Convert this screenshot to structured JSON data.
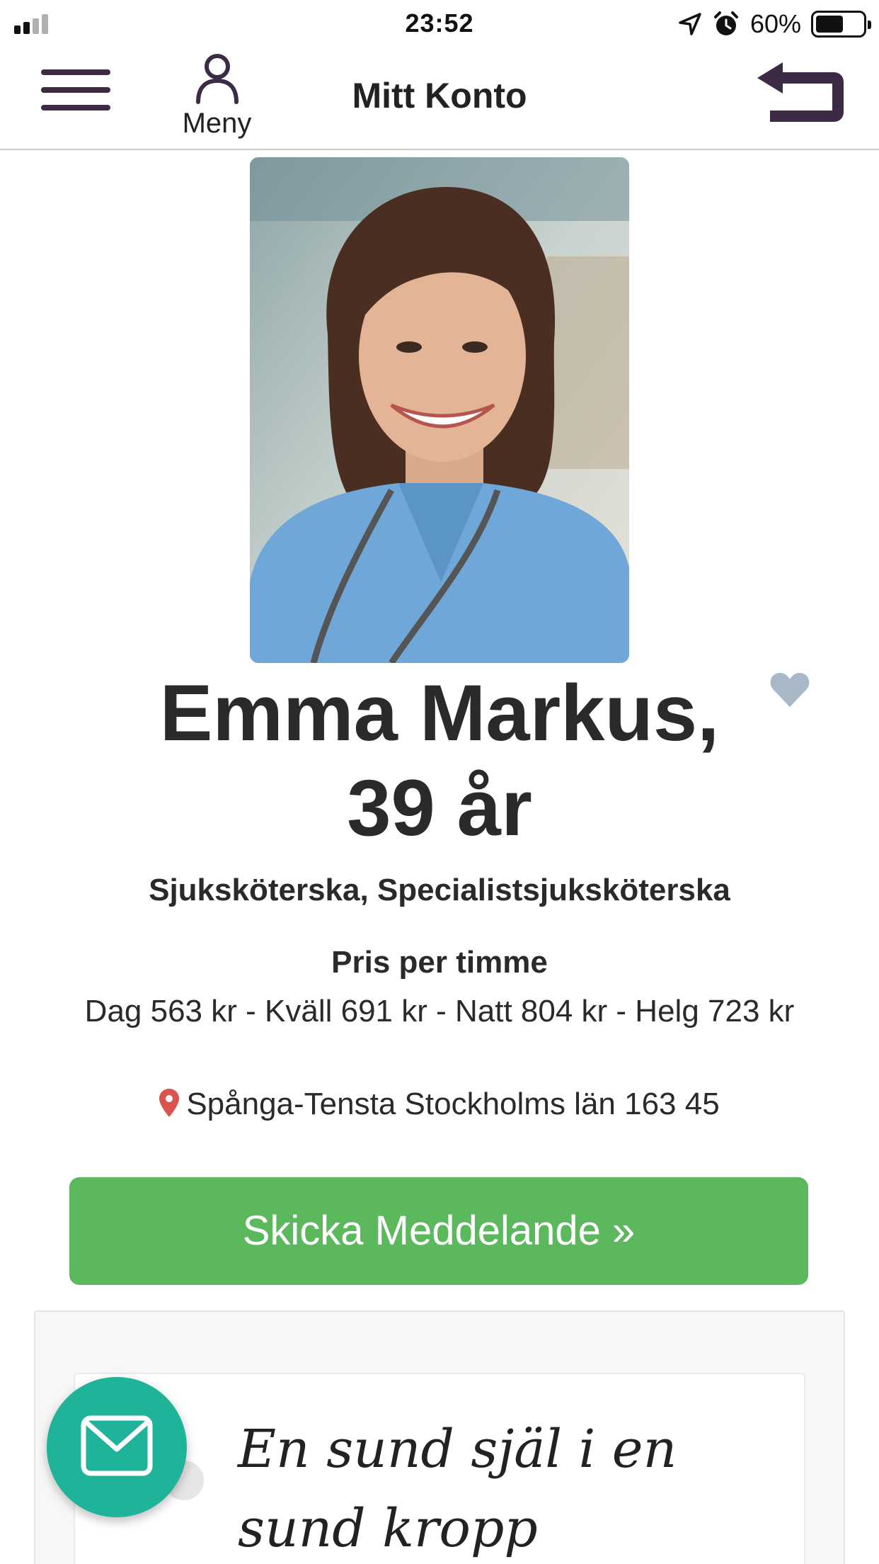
{
  "status_bar": {
    "time": "23:52",
    "battery_percent": "60%",
    "battery_level": 0.6
  },
  "header": {
    "menu_label": "Meny",
    "title": "Mitt Konto"
  },
  "profile": {
    "name": "Emma Markus,",
    "age": "39 år",
    "profession": "Sjuksköterska, Specialistsjuksköterska",
    "price_heading": "Pris per timme",
    "prices": "Dag 563 kr - Kväll 691 kr - Natt 804 kr - Helg 723 kr",
    "location": "Spånga-Tensta Stockholms län 163 45"
  },
  "actions": {
    "send_message": "Skicka Meddelande »"
  },
  "card": {
    "quote_line1": "En sund själ i en",
    "quote_line2": "sund kropp"
  },
  "colors": {
    "brand_dark": "#3d2a45",
    "button_green": "#5cb85c",
    "fab_teal": "#1fb39a",
    "heart": "#a9b8c6",
    "pin": "#d9534f"
  },
  "icons": [
    "signal-icon",
    "location-arrow-icon",
    "alarm-icon",
    "battery-icon",
    "hamburger-icon",
    "user-icon",
    "back-arrow-icon",
    "heart-icon",
    "map-pin-icon",
    "mail-icon"
  ]
}
